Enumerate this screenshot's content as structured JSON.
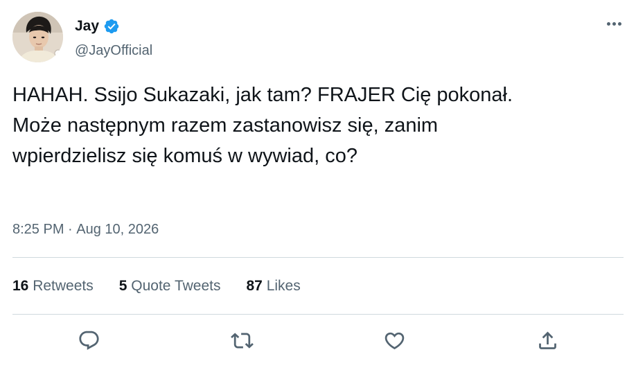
{
  "author": {
    "display_name": "Jay",
    "handle": "@JayOfficial",
    "verified": true
  },
  "tweet": {
    "text": "HAHAH. Ssijo Sukazaki, jak tam? FRAJER Cię pokonał.\nMoże następnym razem zastanowisz się, zanim\nwpierdzielisz się komuś w wywiad, co?",
    "time": "8:25 PM",
    "separator": " · ",
    "date": "Aug 10, 2026"
  },
  "stats": [
    {
      "count": "16",
      "label": "Retweets"
    },
    {
      "count": "5",
      "label": "Quote Tweets"
    },
    {
      "count": "87",
      "label": "Likes"
    }
  ],
  "icons": {
    "more": "more-horizontal-icon",
    "reply": "reply-icon",
    "retweet": "retweet-icon",
    "like": "heart-icon",
    "share": "share-icon",
    "verified": "verified-badge-icon"
  },
  "colors": {
    "verified_blue": "#1d9bf0",
    "text_primary": "#0f1419",
    "text_secondary": "#536471",
    "divider": "#cfd9de"
  }
}
